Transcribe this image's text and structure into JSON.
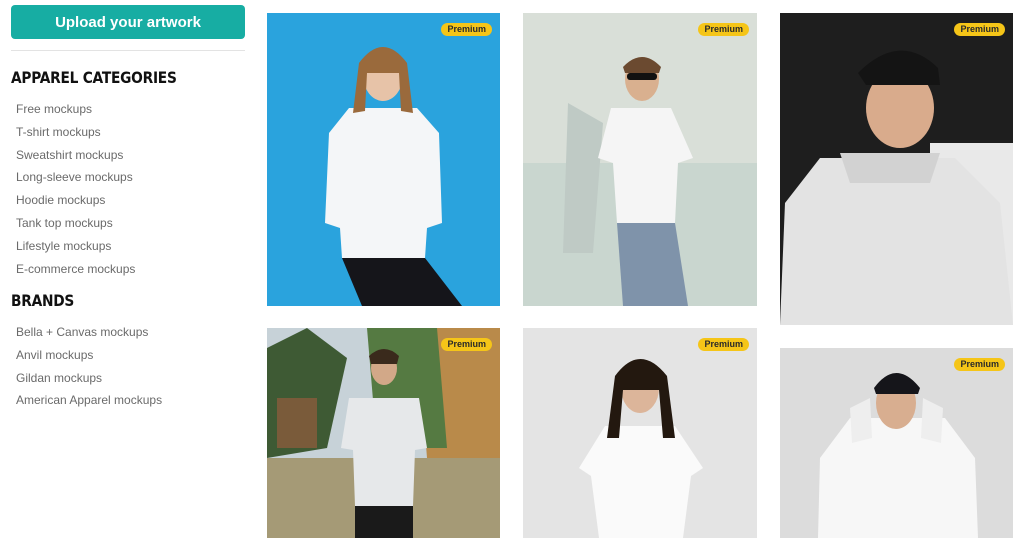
{
  "sidebar": {
    "upload_label": "Upload your artwork",
    "categories_title": "APPAREL CATEGORIES",
    "categories": [
      "Free mockups",
      "T-shirt mockups",
      "Sweatshirt mockups",
      "Long-sleeve mockups",
      "Hoodie mockups",
      "Tank top mockups",
      "Lifestyle mockups",
      "E-commerce mockups"
    ],
    "brands_title": "BRANDS",
    "brands": [
      "Bella + Canvas mockups",
      "Anvil mockups",
      "Gildan mockups",
      "American Apparel mockups"
    ]
  },
  "gallery": {
    "items": [
      {
        "badge": "Premium",
        "garment": "hoodie",
        "background": "#2aa3dd"
      },
      {
        "badge": "Premium",
        "garment": "t-shirt",
        "background": "#d9dfd8"
      },
      {
        "badge": "Premium",
        "garment": "hoodie",
        "background": "#1e1e1e"
      },
      {
        "badge": "Premium",
        "garment": "t-shirt",
        "background": "#6b8c5a"
      },
      {
        "badge": "Premium",
        "garment": "t-shirt",
        "background": "#e4e4e4"
      },
      {
        "badge": "Premium",
        "garment": "hoodie",
        "background": "#dcdcdc"
      }
    ]
  },
  "colors": {
    "accent": "#17ada3",
    "badge": "#f5c518"
  }
}
